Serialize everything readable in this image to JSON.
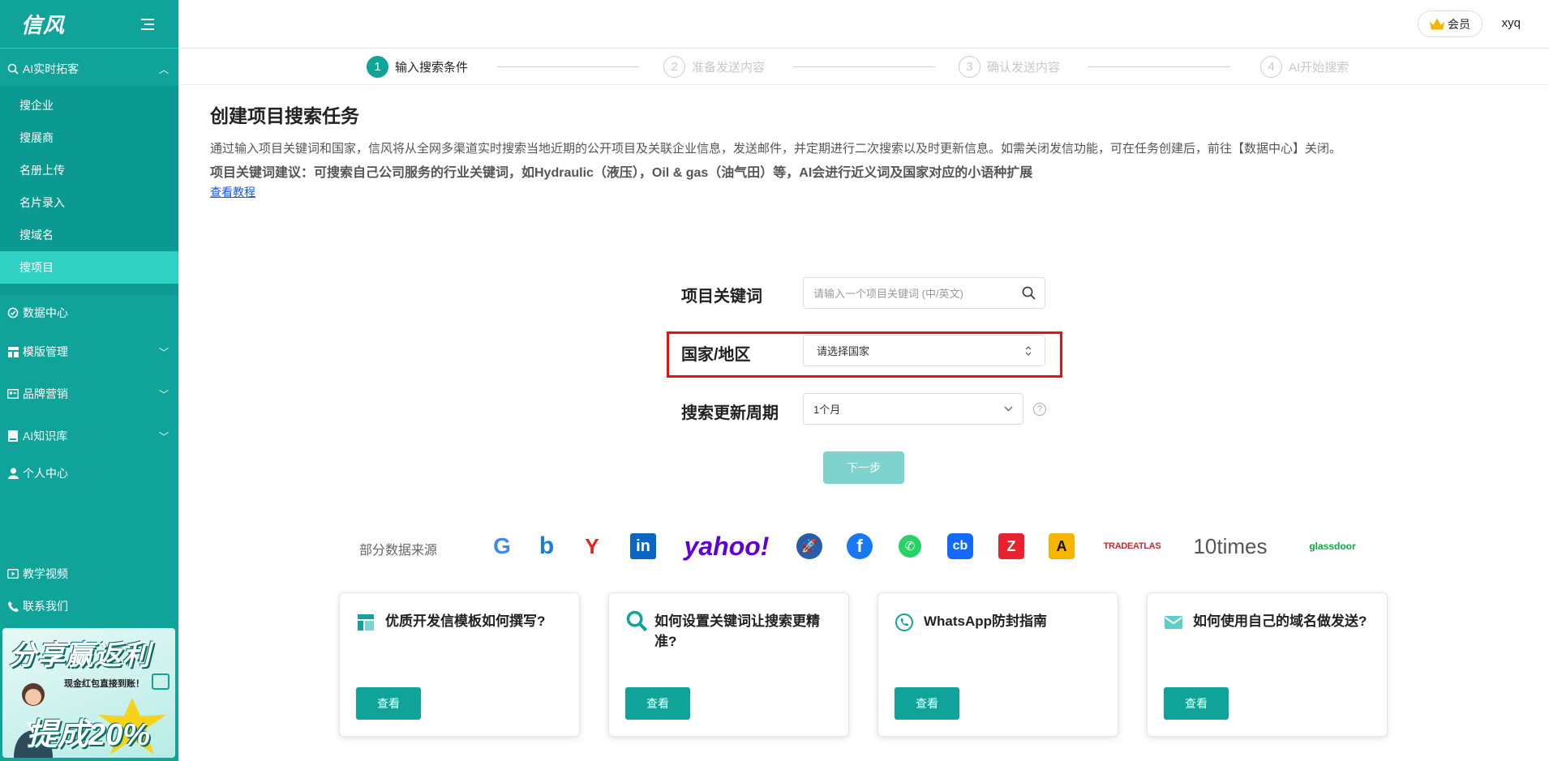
{
  "brand": {
    "name": "信风"
  },
  "sidebar": {
    "group_ai": "AI实时拓客",
    "sub_items": [
      "搜企业",
      "搜展商",
      "名册上传",
      "名片录入",
      "搜域名",
      "搜项目"
    ],
    "groups": [
      "数据中心",
      "模版管理",
      "品牌营销",
      "AI知识库",
      "个人中心"
    ],
    "bottom": [
      "教学视频",
      "联系我们"
    ],
    "promo": {
      "title": "分享赢返利",
      "subtitle": "现金红包直接到账！",
      "rate": "提成20%"
    }
  },
  "header": {
    "vip": "会员",
    "user": "xyq"
  },
  "steps": [
    {
      "num": "1",
      "label": "输入搜索条件"
    },
    {
      "num": "2",
      "label": "准备发送内容"
    },
    {
      "num": "3",
      "label": "确认发送内容"
    },
    {
      "num": "4",
      "label": "AI开始搜索"
    }
  ],
  "intro": {
    "title": "创建项目搜索任务",
    "desc": "通过输入项目关键词和国家，信风将从全网多渠道实时搜索当地近期的公开项目及关联企业信息，发送邮件，并定期进行二次搜索以及时更新信息。如需关闭发信功能，可在任务创建后，前往【数据中心】关闭。",
    "tip": "项目关键词建议：可搜索自己公司服务的行业关键词，如Hydraulic（液压），Oil & gas（油气田）等，AI会进行近义词及国家对应的小语种扩展",
    "link": "查看教程"
  },
  "form": {
    "keyword_label": "项目关键词",
    "keyword_placeholder": "请输入一个项目关键词 (中/英文)",
    "country_label": "国家/地区",
    "country_placeholder": "请选择国家",
    "period_label": "搜索更新周期",
    "period_value": "1个月",
    "next": "下一步"
  },
  "sources": {
    "label": "部分数据来源",
    "logos": [
      "G",
      "b",
      "Y",
      "in",
      "yahoo!",
      "🚀",
      "f",
      "✆",
      "cb",
      "Z",
      "A",
      "TRADEATLAS",
      "10times",
      "glassdoor"
    ]
  },
  "cards": [
    {
      "title": "优质开发信模板如何撰写?",
      "button": "查看"
    },
    {
      "title": "如何设置关键词让搜索更精准?",
      "button": "查看"
    },
    {
      "title": "WhatsApp防封指南",
      "button": "查看"
    },
    {
      "title": "如何使用自己的域名做发送?",
      "button": "查看"
    }
  ]
}
